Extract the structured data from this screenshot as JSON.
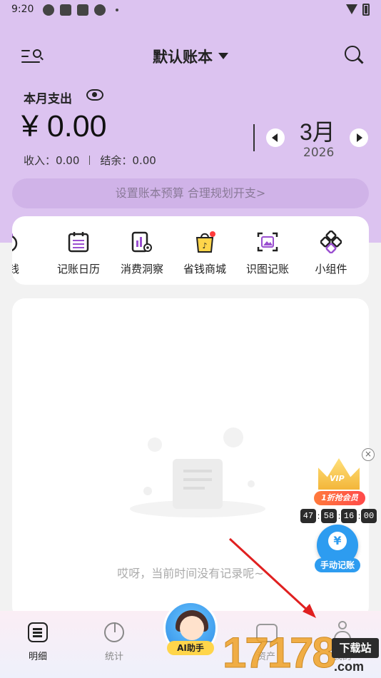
{
  "status_bar": {
    "time": "9:20"
  },
  "header": {
    "ledger_name": "默认账本",
    "month_expense_label": "本月支出",
    "amount": "¥ 0.00",
    "income": "收入：0.00",
    "balance": "结余：0.00",
    "month": "3月",
    "year": "2026",
    "budget_prompt": "设置账本预算 合理规划开支>"
  },
  "shortcuts": [
    {
      "label": "存钱",
      "icon": "piggy-bank-icon"
    },
    {
      "label": "记账日历",
      "icon": "calendar-icon"
    },
    {
      "label": "消费洞察",
      "icon": "insight-icon"
    },
    {
      "label": "省钱商城",
      "icon": "shopping-bag-icon"
    },
    {
      "label": "识图记账",
      "icon": "image-scan-icon"
    },
    {
      "label": "小组件",
      "icon": "widget-icon"
    }
  ],
  "records": {
    "empty_text": "哎呀，当前时间没有记录呢~"
  },
  "vip_promo": {
    "crown_text": "VIP",
    "badge": "1折抢会员",
    "timer": [
      "47",
      "58",
      "16",
      "00"
    ]
  },
  "manual_entry": {
    "label": "手动记账",
    "symbol": "¥"
  },
  "tabbar": {
    "tabs": [
      {
        "label": "明细"
      },
      {
        "label": "统计"
      },
      {
        "label": "资产"
      },
      {
        "label": "我的"
      }
    ],
    "ai_label": "AI助手"
  },
  "watermark": {
    "number": "17178",
    "tag": "下载站",
    "suffix": ".com"
  },
  "colors": {
    "header_bg": "#dcc3f0",
    "accent_blue": "#2d9cf0",
    "vip_orange": "#ff7a3c",
    "watermark": "#f0a226"
  }
}
